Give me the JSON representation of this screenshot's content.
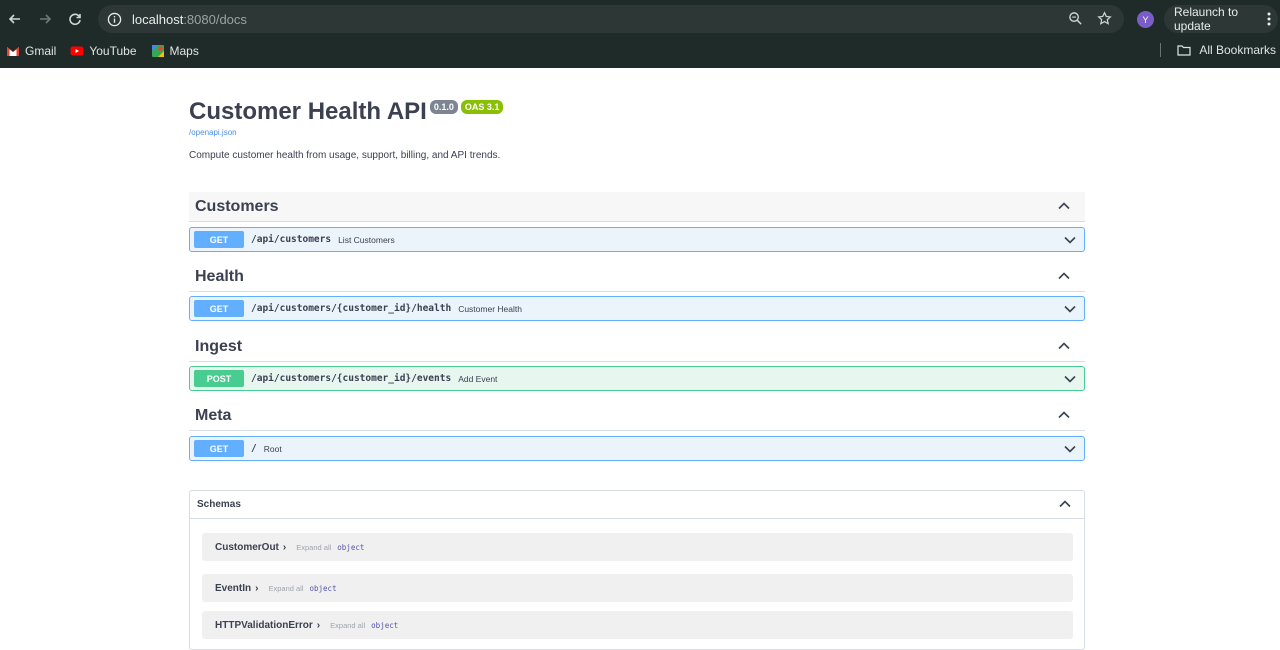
{
  "browser": {
    "url_host": "localhost",
    "url_rest": ":8080/docs",
    "avatar_letter": "Y",
    "relaunch_label": "Relaunch to update",
    "bookmarks": [
      {
        "label": "Gmail",
        "icon": "gmail-icon"
      },
      {
        "label": "YouTube",
        "icon": "youtube-icon"
      },
      {
        "label": "Maps",
        "icon": "maps-icon"
      }
    ],
    "all_bookmarks_label": "All Bookmarks"
  },
  "api": {
    "title": "Customer Health API",
    "version": "0.1.0",
    "oas": "OAS 3.1",
    "spec_link": "/openapi.json",
    "description": "Compute customer health from usage, support, billing, and API trends."
  },
  "tags": [
    {
      "name": "Customers",
      "ops": [
        {
          "method": "GET",
          "path": "/api/customers",
          "summary": "List Customers"
        }
      ]
    },
    {
      "name": "Health",
      "ops": [
        {
          "method": "GET",
          "path": "/api/customers/{customer_id}/health",
          "summary": "Customer Health"
        }
      ]
    },
    {
      "name": "Ingest",
      "ops": [
        {
          "method": "POST",
          "path": "/api/customers/{customer_id}/events",
          "summary": "Add Event"
        }
      ]
    },
    {
      "name": "Meta",
      "ops": [
        {
          "method": "GET",
          "path": "/",
          "summary": "Root"
        }
      ]
    }
  ],
  "schemas": {
    "title": "Schemas",
    "expand_all": "Expand all",
    "models": [
      {
        "name": "CustomerOut",
        "type": "object"
      },
      {
        "name": "EventIn",
        "type": "object"
      },
      {
        "name": "HTTPValidationError",
        "type": "object"
      }
    ]
  },
  "colors": {
    "get": "#61affe",
    "post": "#49cc90",
    "chrome_bg": "#1f2b29"
  }
}
